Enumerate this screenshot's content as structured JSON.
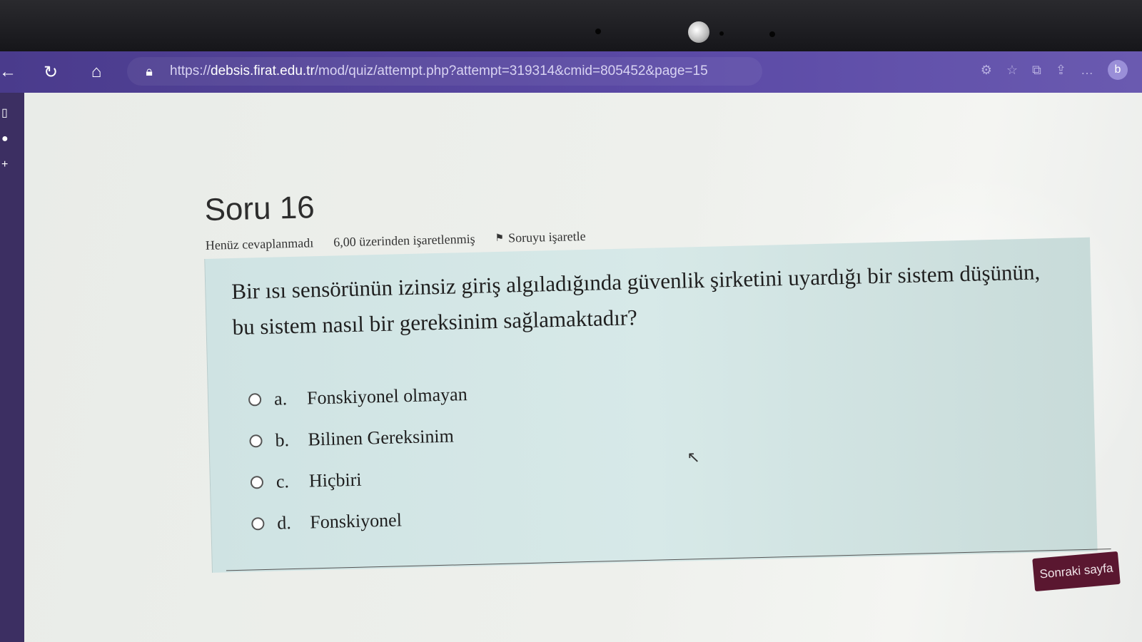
{
  "browser": {
    "url_prefix": "https://",
    "url_domain": "debsis.firat.edu.tr",
    "url_path": "/mod/quiz/attempt.php?attempt=319314&cmid=805452&page=15"
  },
  "question": {
    "title": "Soru 16",
    "status": "Henüz cevaplanmadı",
    "grade": "6,00 üzerinden işaretlenmiş",
    "flag_label": "Soruyu işaretle",
    "text_line1": "Bir ısı sensörünün izinsiz giriş algıladığında güvenlik şirketini uyardığı bir sistem düşünün,",
    "text_line2": "bu sistem nasıl bir gereksinim sağlamaktadır?",
    "answers": [
      {
        "letter": "a.",
        "label": "Fonskiyonel olmayan",
        "selected": false
      },
      {
        "letter": "b.",
        "label": "Bilinen Gereksinim",
        "selected": false
      },
      {
        "letter": "c.",
        "label": "Hiçbiri",
        "selected": false
      },
      {
        "letter": "d.",
        "label": "Fonskiyonel",
        "selected": false
      }
    ]
  },
  "navigation": {
    "next_label": "Sonraki sayfa"
  },
  "colors": {
    "browser_bar": "#5b4aa6",
    "question_box": "#d7e9e8",
    "next_button": "#5a1730"
  }
}
